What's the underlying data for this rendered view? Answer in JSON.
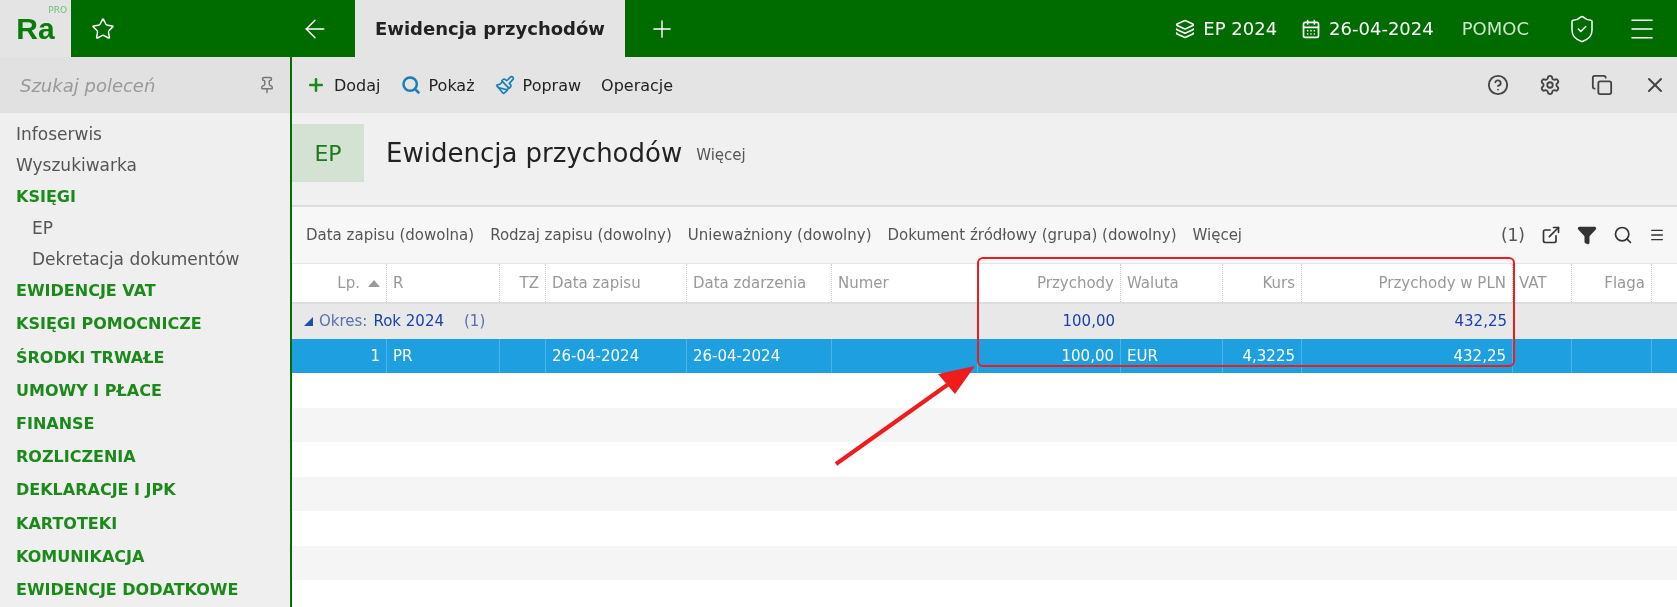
{
  "topbar": {
    "logo": "Ra",
    "logo_badge": "PRO",
    "tabs": [
      {
        "label": "Ewidencja przychodów",
        "selected": true
      }
    ],
    "year": "EP 2024",
    "date": "26-04-2024",
    "help": "POMOC"
  },
  "sidebar": {
    "search_placeholder": "Szukaj poleceń",
    "items": [
      {
        "label": "Infoserwis",
        "kind": "link"
      },
      {
        "label": "Wyszukiwarka",
        "kind": "link"
      },
      {
        "label": "KSIĘGI",
        "kind": "section",
        "children": [
          {
            "label": "EP"
          },
          {
            "label": "Dekretacja dokumentów"
          }
        ]
      },
      {
        "label": "EWIDENCJE VAT",
        "kind": "section"
      },
      {
        "label": "KSIĘGI POMOCNICZE",
        "kind": "section"
      },
      {
        "label": "ŚRODKI TRWAŁE",
        "kind": "section"
      },
      {
        "label": "UMOWY I PŁACE",
        "kind": "section"
      },
      {
        "label": "FINANSE",
        "kind": "section"
      },
      {
        "label": "ROZLICZENIA",
        "kind": "section"
      },
      {
        "label": "DEKLARACJE I JPK",
        "kind": "section"
      },
      {
        "label": "KARTOTEKI",
        "kind": "section"
      },
      {
        "label": "KOMUNIKACJA",
        "kind": "section"
      },
      {
        "label": "EWIDENCJE DODATKOWE",
        "kind": "section"
      }
    ]
  },
  "toolbar": [
    {
      "label": "Dodaj",
      "kind": "add"
    },
    {
      "label": "Pokaż",
      "kind": "show"
    },
    {
      "label": "Popraw",
      "kind": "edit"
    },
    {
      "label": "Operacje",
      "kind": "plain"
    }
  ],
  "header": {
    "badge": "EP",
    "title": "Ewidencja przychodów",
    "more": "Więcej"
  },
  "filters": [
    "Data zapisu (dowolna)",
    "Rodzaj zapisu (dowolny)",
    "Unieważniony (dowolny)",
    "Dokument źródłowy (grupa) (dowolny)",
    "Więcej"
  ],
  "filter_count": "(1)",
  "table": {
    "columns": [
      {
        "label": "Lp.",
        "sorted": true
      },
      {
        "label": "R",
        "sorted": false
      },
      {
        "label": "TZ",
        "sorted": false
      },
      {
        "label": "Data zapisu",
        "sorted": false
      },
      {
        "label": "Data zdarzenia",
        "sorted": false
      },
      {
        "label": "Numer",
        "sorted": false
      },
      {
        "label": "Przychody",
        "sorted": false
      },
      {
        "label": "Waluta",
        "sorted": false
      },
      {
        "label": "Kurs",
        "sorted": false
      },
      {
        "label": "Przychody w PLN",
        "sorted": false
      },
      {
        "label": "VAT",
        "sorted": false
      },
      {
        "label": "Flaga",
        "sorted": false
      }
    ],
    "group": {
      "label": "Okres:",
      "value": "Rok 2024",
      "count": "(1)",
      "expanded": true,
      "totals": {
        "6": "100,00",
        "9": "432,25"
      }
    },
    "rows": [
      {
        "selected": true,
        "cells": [
          "1",
          "PR",
          "",
          "26-04-2024",
          "26-04-2024",
          "",
          "100,00",
          "EUR",
          "4,3225",
          "432,25",
          "",
          ""
        ]
      }
    ]
  }
}
